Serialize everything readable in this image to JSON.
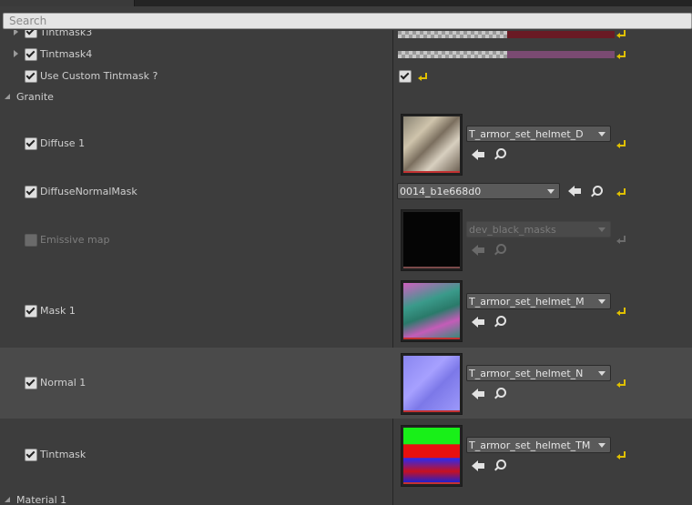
{
  "search": {
    "placeholder": "Search"
  },
  "rows": {
    "tintmask3": {
      "label": "Tintmask3",
      "swatch_color": "#6a1a24"
    },
    "tintmask4": {
      "label": "Tintmask4",
      "swatch_color": "#7a4a72"
    },
    "use_custom": {
      "label": "Use Custom Tintmask ?",
      "checked": true
    }
  },
  "categories": {
    "granite": "Granite",
    "material1": "Material 1"
  },
  "textures": [
    {
      "label": "Diffuse 1",
      "value": "T_armor_set_helmet_D",
      "enabled": true
    },
    {
      "label": "DiffuseNormalMask",
      "value": "0014_b1e668d0",
      "enabled": true
    },
    {
      "label": "Emissive map",
      "value": "dev_black_masks",
      "enabled": false
    },
    {
      "label": "Mask 1",
      "value": "T_armor_set_helmet_M",
      "enabled": true
    },
    {
      "label": "Normal 1",
      "value": "T_armor_set_helmet_N",
      "enabled": true
    },
    {
      "label": "Tintmask",
      "value": "T_armor_set_helmet_TM",
      "enabled": true
    }
  ],
  "icons": {
    "expand": "triangle-right-icon",
    "collapse": "triangle-down-icon",
    "reset": "reset-to-default-icon",
    "use_selected": "arrow-left-icon",
    "browse": "magnifier-icon"
  }
}
